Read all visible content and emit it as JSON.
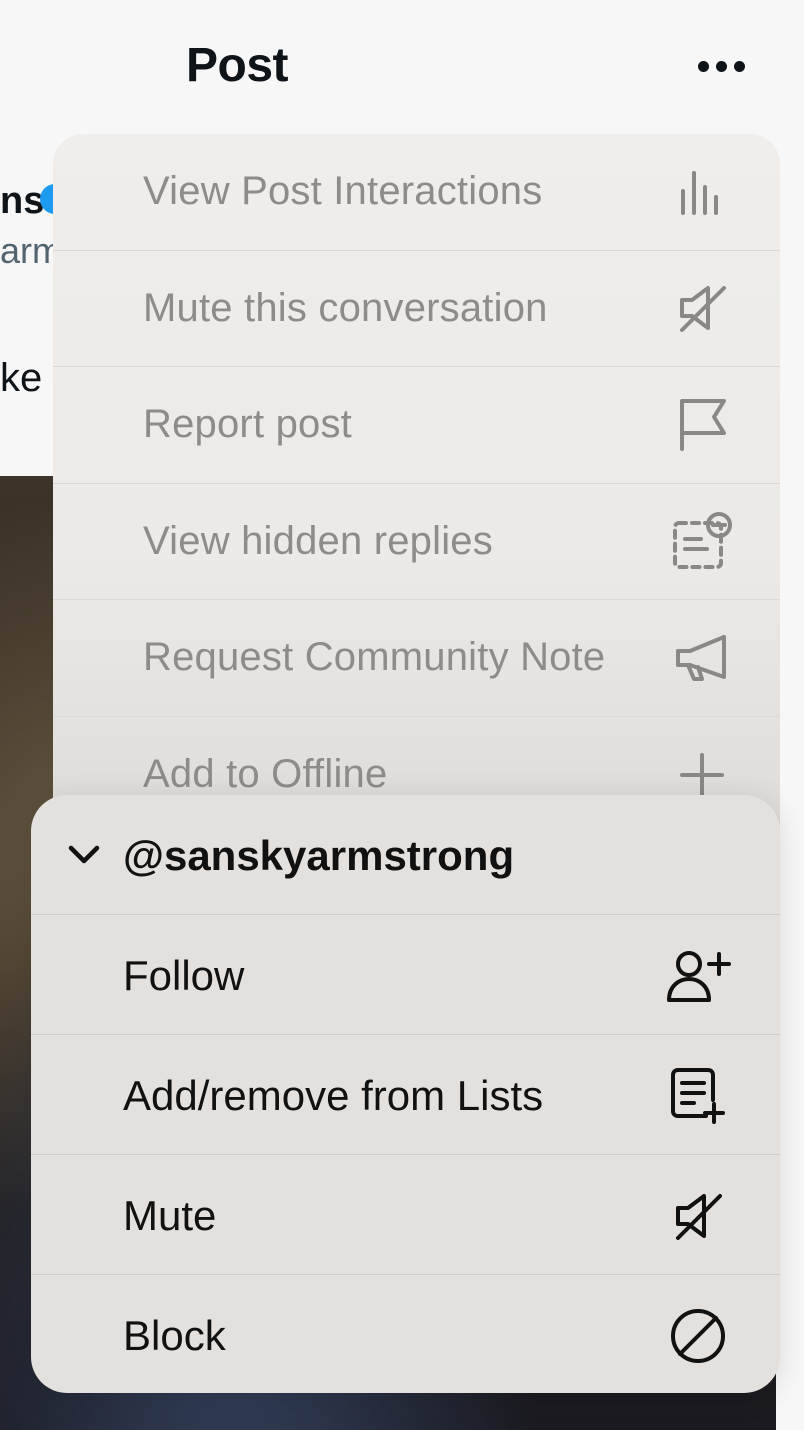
{
  "header": {
    "title": "Post",
    "more_icon": "more-horizontal-icon"
  },
  "background_post": {
    "name_fragment": "ns",
    "handle_fragment": "arm",
    "text_fragment": "ke"
  },
  "post_menu": {
    "items": [
      {
        "label": "View Post Interactions",
        "icon": "bar-chart-icon"
      },
      {
        "label": "Mute this conversation",
        "icon": "speaker-mute-icon"
      },
      {
        "label": "Report post",
        "icon": "flag-icon"
      },
      {
        "label": "View hidden replies",
        "icon": "hidden-replies-icon"
      },
      {
        "label": "Request Community Note",
        "icon": "megaphone-icon"
      },
      {
        "label": "Add to Offline",
        "icon": "plus-icon"
      }
    ]
  },
  "user_menu": {
    "handle": "@sanskyarmstrong",
    "items": [
      {
        "label": "Follow",
        "icon": "follow-user-icon"
      },
      {
        "label": "Add/remove from Lists",
        "icon": "list-add-icon"
      },
      {
        "label": "Mute",
        "icon": "speaker-mute-icon"
      },
      {
        "label": "Block",
        "icon": "block-icon"
      }
    ]
  },
  "colors": {
    "upper_menu_bg": "#f0edea",
    "lower_menu_bg": "#e4e0dd",
    "faded_text": "#8e8c8a",
    "verified_blue": "#1d9bf0"
  }
}
